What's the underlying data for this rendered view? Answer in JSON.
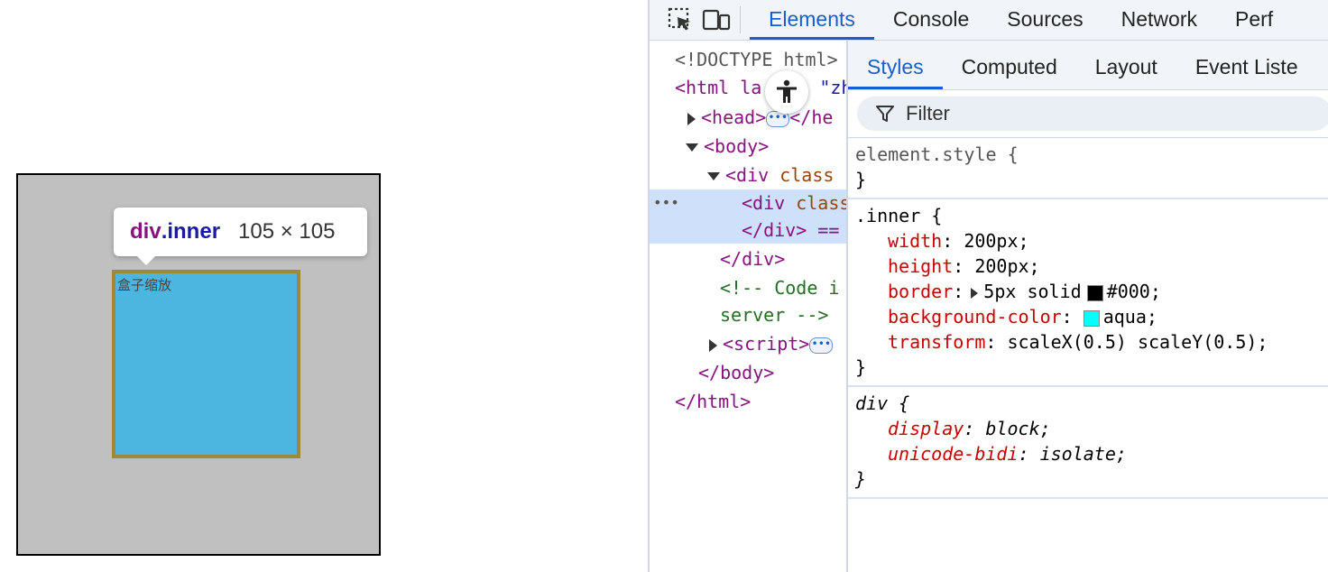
{
  "page": {
    "inner_box_text": "盒子缩放",
    "tooltip": {
      "tag": "div",
      "class": ".inner",
      "size": "105 × 105"
    }
  },
  "devtools": {
    "tabs": [
      "Elements",
      "Console",
      "Sources",
      "Network",
      "Perf"
    ],
    "active_tab": "Elements",
    "dom": {
      "doctype": "<!DOCTYPE html>",
      "html_open_a": "<html la",
      "html_open_b": "\"zh-",
      "head_open": "<head>",
      "head_close": "</he",
      "body_open": "<body>",
      "div_open_tag": "<div ",
      "div_open_attr": "class",
      "inner_div_tag": "<div ",
      "inner_div_attr": "class",
      "inner_div_close": "</div> ==",
      "div_close": "</div>",
      "comment_1": "<!-- Code i",
      "comment_2": "server -->",
      "script_open": "<script>",
      "body_close": "</body>",
      "html_close": "</html>",
      "selected_marker": "•••",
      "ellipsis": "•••"
    },
    "styles": {
      "tabs": [
        "Styles",
        "Computed",
        "Layout",
        "Event Liste"
      ],
      "active_tab": "Styles",
      "filter_label": "Filter",
      "rules": {
        "element_style": {
          "selector": "element.style {",
          "close": "}"
        },
        "inner": {
          "selector": ".inner {",
          "width_name": "width",
          "width_value": "200px;",
          "height_name": "height",
          "height_value": "200px;",
          "border_name": "border",
          "border_value_a": "5px solid",
          "border_value_b": "#000;",
          "bg_name": "background-color",
          "bg_value": "aqua;",
          "transform_name": "transform",
          "transform_value": "scaleX(0.5) scaleY(0.5);",
          "close": "}"
        },
        "div": {
          "selector": "div {",
          "display_name": "display",
          "display_value": "block;",
          "bidi_name": "unicode-bidi",
          "bidi_value": "isolate;",
          "close": "}"
        }
      }
    }
  },
  "colors": {
    "accent": "#1a5fc7",
    "outer_box_bg": "#c0c0c0",
    "inner_box_bg": "#4cb5e0",
    "swatch_black": "#000000",
    "swatch_aqua": "#00ffff"
  },
  "icons": [
    "inspect-element-icon",
    "device-toolbar-icon",
    "accessibility-icon",
    "filter-icon"
  ]
}
